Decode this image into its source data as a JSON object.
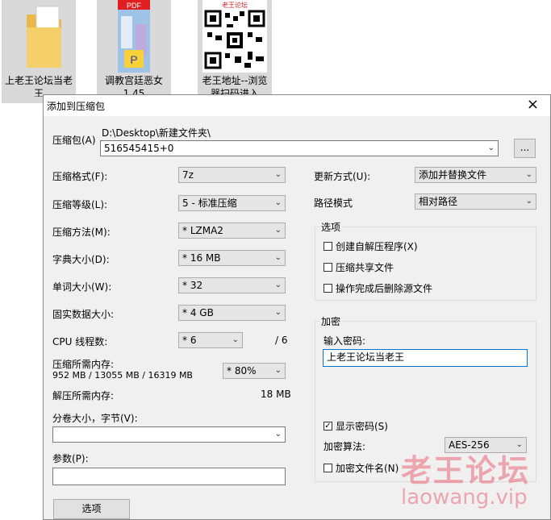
{
  "desktop": {
    "files": [
      {
        "name": "上老王论坛当老王",
        "icon": "folder-icon"
      },
      {
        "name": "调教宫廷恶女1.45",
        "badge": "PDF"
      },
      {
        "name": "老王地址--浏览器扫码进入",
        "header": "老王论坛"
      }
    ]
  },
  "dialog": {
    "title": "添加到压缩包",
    "close": "×",
    "archive": {
      "label": "压缩包(A)",
      "path": "D:\\Desktop\\新建文件夹\\",
      "value": "516545415+0",
      "browse": "..."
    },
    "left": {
      "format_label": "压缩格式(F):",
      "format_value": "7z",
      "level_label": "压缩等级(L):",
      "level_value": "5 - 标准压缩",
      "method_label": "压缩方法(M):",
      "method_value": "* LZMA2",
      "dict_label": "字典大小(D):",
      "dict_value": "* 16 MB",
      "word_label": "单词大小(W):",
      "word_value": "* 32",
      "solid_label": "固实数据大小:",
      "solid_value": "* 4 GB",
      "threads_label": "CPU 线程数:",
      "threads_value": "* 6",
      "threads_total": "/ 6",
      "mem_label": "压缩所需内存:",
      "mem_value": "952 MB / 13055 MB / 16319 MB",
      "mem_percent": "* 80%",
      "decomp_label": "解压所需内存:",
      "decomp_value": "18 MB",
      "split_label": "分卷大小，字节(V):",
      "split_value": "",
      "params_label": "参数(P):",
      "params_value": "",
      "options_button": "选项"
    },
    "right": {
      "update_label": "更新方式(U):",
      "update_value": "添加并替换文件",
      "path_label": "路径模式",
      "path_value": "相对路径",
      "options_title": "选项",
      "opt_sfx": "创建自解压程序(X)",
      "opt_shared": "压缩共享文件",
      "opt_delete": "操作完成后删除源文件",
      "encrypt_title": "加密",
      "password_label": "输入密码:",
      "password_value": "上老王论坛当老王",
      "show_password": "显示密码(S)",
      "algo_label": "加密算法:",
      "algo_value": "AES-256",
      "encrypt_names": "加密文件名(N)"
    }
  },
  "watermark": {
    "cn": "老王论坛",
    "en": "laowang.vip"
  }
}
